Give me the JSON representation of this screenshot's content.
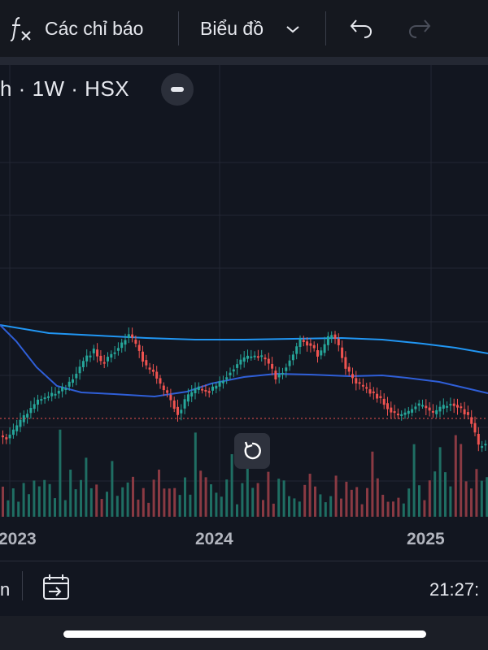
{
  "toolbar": {
    "indicators_label": "Các chỉ báo",
    "chart_type_label": "Biểu đồ"
  },
  "symbol": {
    "label": "h · 1W · HSX"
  },
  "chart": {
    "colors": {
      "up": "#26a69a",
      "down": "#ef5350",
      "ma_long": "#2196f3",
      "ma_short": "#2f5fd8",
      "grid": "#232733",
      "price_line": "#ef5350"
    },
    "x_labels": [
      "2023",
      "2024",
      "2025"
    ]
  },
  "bottom": {
    "left_label": "n",
    "time": "21:27:"
  },
  "icons": {
    "formula": "fx-icon",
    "chevron": "chevron-down-icon",
    "undo": "undo-icon",
    "redo": "redo-icon",
    "collapse": "minus-icon",
    "reset": "reset-icon",
    "calendar": "calendar-goto-icon"
  }
}
